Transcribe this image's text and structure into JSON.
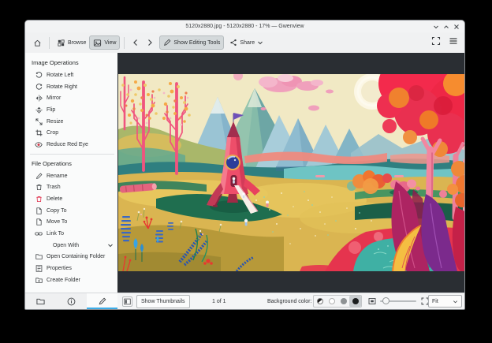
{
  "window": {
    "title": "5120x2880.jpg - 5120x2880 - 17% — Gwenview"
  },
  "toolbar": {
    "browse_label": "Browse",
    "view_label": "View",
    "show_editing_tools_label": "Show Editing Tools",
    "share_label": "Share"
  },
  "sidebar": {
    "image_operations": {
      "header": "Image Operations",
      "items": [
        "Rotate Left",
        "Rotate Right",
        "Mirror",
        "Flip",
        "Resize",
        "Crop",
        "Reduce Red Eye"
      ]
    },
    "file_operations": {
      "header": "File Operations",
      "items": [
        "Rename",
        "Trash",
        "Delete",
        "Copy To",
        "Move To",
        "Link To",
        "Open With",
        "Open Containing Folder",
        "Properties",
        "Create Folder"
      ]
    }
  },
  "statusbar": {
    "show_thumbnails_label": "Show Thumbnails",
    "page_indicator": "1 of 1",
    "background_color_label": "Background color:",
    "zoom_mode": "Fit"
  },
  "viewer": {
    "image_alt": "colorful illustration of a pink rocket in an autumn valley"
  },
  "colors": {
    "accent": "#3daee9",
    "viewer_bg": "#2a2e33",
    "delete_red": "#e0304c"
  }
}
